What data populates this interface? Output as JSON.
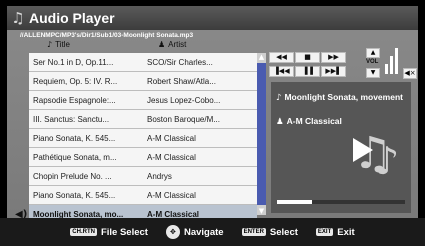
{
  "app": {
    "title": "Audio Player",
    "title_icon": "music-note-icon"
  },
  "path": "//ALLENMPC/MP3's/Dir1/Sub1/03-Moonlight Sonata.mp3",
  "columns": {
    "title": "Title",
    "artist": "Artist"
  },
  "tracks": [
    {
      "title": "Ser No.1 in D, Op.11...",
      "artist": "SCO/Sir Charles..."
    },
    {
      "title": "Requiem, Op. 5: IV. R...",
      "artist": "Robert Shaw/Atla..."
    },
    {
      "title": "Rapsodie Espagnole:...",
      "artist": "Jesus Lopez-Cobo..."
    },
    {
      "title": "III. Sanctus: Sanctu...",
      "artist": "Boston Baroque/M..."
    },
    {
      "title": "Piano Sonata, K. 545...",
      "artist": "A-M Classical"
    },
    {
      "title": "Pathétique Sonata, m...",
      "artist": "A-M Classical"
    },
    {
      "title": "Chopin Prelude No. ...",
      "artist": "Andrys"
    },
    {
      "title": "Piano Sonata, K. 545...",
      "artist": "A-M Classical"
    },
    {
      "title": "Moonlight Sonata, mo...",
      "artist": "A-M Classical",
      "selected": true
    }
  ],
  "controls": {
    "rewind": "◀◀",
    "stop": "■",
    "fast_forward": "▶▶",
    "prev": "▐◀◀",
    "pause": "▐▐",
    "next": "▶▶▌",
    "vol_label": "VOL",
    "vol_up": "▲",
    "vol_down": "▼",
    "mute": "◀×"
  },
  "now_playing": {
    "title": "Moonlight Sonata, movement",
    "artist": "A-M Classical",
    "progress": 0.27
  },
  "footer": [
    {
      "key": "CH.RTN",
      "label": "File Select"
    },
    {
      "key": "✥",
      "label": "Navigate"
    },
    {
      "key": "ENTER",
      "label": "Select"
    },
    {
      "key": "EXIT",
      "label": "Exit"
    }
  ],
  "colors": {
    "selected_row": "#b9c3d0",
    "scroll_thumb": "#4a5bb0",
    "panel": "#808080"
  }
}
